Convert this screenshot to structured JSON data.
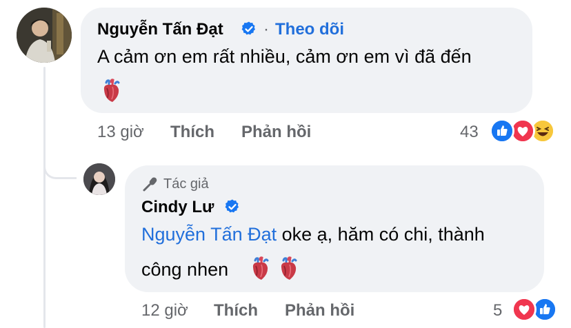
{
  "comment": {
    "author": "Nguyễn Tấn Đạt",
    "follow_label": "Theo dõi",
    "separator": "·",
    "text": "A cảm ơn em rất nhiều, cảm ơn em vì đã đến",
    "time": "13 giờ",
    "like_label": "Thích",
    "reply_label": "Phản hồi",
    "reaction_count": "43",
    "reactions": [
      "like-icon",
      "love-icon",
      "haha-icon"
    ]
  },
  "reply": {
    "badge_label": "Tác giả",
    "author": "Cindy Lư",
    "mention": "Nguyễn Tấn Đạt",
    "text_line1": " oke ạ, hăm có chi, thành",
    "text_line2": "công nhen",
    "time": "12 giờ",
    "like_label": "Thích",
    "reply_label": "Phản hồi",
    "reaction_count": "5",
    "reactions": [
      "love-icon",
      "like-icon"
    ]
  },
  "colors": {
    "link": "#216fdb",
    "muted": "#65676b",
    "bubble": "#f0f2f5",
    "verified": "#1877f2"
  }
}
